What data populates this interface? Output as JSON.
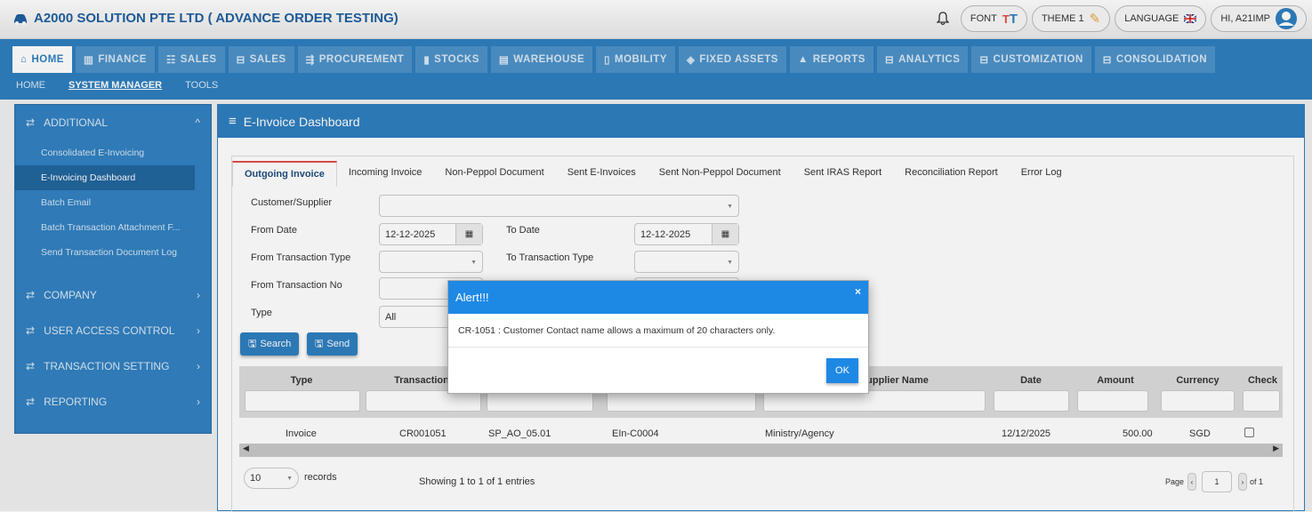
{
  "app": {
    "title": "A2000 SOLUTION PTE LTD ( ADVANCE ORDER TESTING)"
  },
  "toolbar": {
    "font_label": "FONT",
    "theme_label": "THEME 1",
    "language_label": "LANGUAGE",
    "user_label": "HI, A21IMP"
  },
  "modules": [
    {
      "label": "HOME",
      "icon": "home-icon"
    },
    {
      "label": "FINANCE",
      "icon": "bank-icon"
    },
    {
      "label": "SALES",
      "icon": "users-icon"
    },
    {
      "label": "SALES",
      "icon": "cart-icon"
    },
    {
      "label": "PROCUREMENT",
      "icon": "truck-icon"
    },
    {
      "label": "STOCKS",
      "icon": "bar-chart-icon"
    },
    {
      "label": "WAREHOUSE",
      "icon": "warehouse-icon"
    },
    {
      "label": "MOBILITY",
      "icon": "mobile-icon"
    },
    {
      "label": "FIXED ASSETS",
      "icon": "asset-icon"
    },
    {
      "label": "REPORTS",
      "icon": "report-icon"
    },
    {
      "label": "ANALYTICS",
      "icon": "cart-icon"
    },
    {
      "label": "CUSTOMIZATION",
      "icon": "cart-icon"
    },
    {
      "label": "CONSOLIDATION",
      "icon": "cart-icon"
    }
  ],
  "subnav": [
    "HOME",
    "SYSTEM MANAGER",
    "TOOLS"
  ],
  "sidebar": {
    "groups": [
      "ADDITIONAL",
      "COMPANY",
      "USER ACCESS CONTROL",
      "TRANSACTION SETTING",
      "REPORTING"
    ],
    "items": [
      "Consolidated E-Invoicing",
      "E-Invoicing Dashboard",
      "Batch Email",
      "Batch Transaction Attachment F...",
      "Send Transaction Document Log"
    ]
  },
  "panel": {
    "title": "E-Invoice Dashboard"
  },
  "tabs": [
    "Outgoing Invoice",
    "Incoming Invoice",
    "Non-Peppol Document",
    "Sent E-Invoices",
    "Sent Non-Peppol Document",
    "Sent IRAS Report",
    "Reconciliation Report",
    "Error Log"
  ],
  "form": {
    "customer_label": "Customer/Supplier",
    "from_date_label": "From Date",
    "from_date": "12-12-2025",
    "to_date_label": "To Date",
    "to_date": "12-12-2025",
    "from_type_label": "From Transaction Type",
    "to_type_label": "To Transaction Type",
    "from_no_label": "From Transaction No",
    "type_label": "Type",
    "type_value": "All",
    "search_label": "Search",
    "send_label": "Send"
  },
  "grid": {
    "headers": [
      "Type",
      "Transaction",
      "upplier Name",
      "Date",
      "Amount",
      "Currency",
      "Check"
    ],
    "row": {
      "type": "Invoice",
      "transaction": "CR001051",
      "ref": "SP_AO_05.01",
      "code": "EIn-C0004",
      "name": "Ministry/Agency",
      "date": "12/12/2025",
      "amount": "500.00",
      "currency": "SGD"
    }
  },
  "footer": {
    "page_size": "10",
    "records_label": "records",
    "showing": "Showing 1 to 1 of 1 entries",
    "page_label": "Page",
    "page": "1",
    "of_label": "of 1"
  },
  "modal": {
    "title": "Alert!!!",
    "message": "CR-1051 : Customer Contact name allows a maximum of 20 characters only.",
    "ok_label": "OK",
    "close": "×"
  }
}
